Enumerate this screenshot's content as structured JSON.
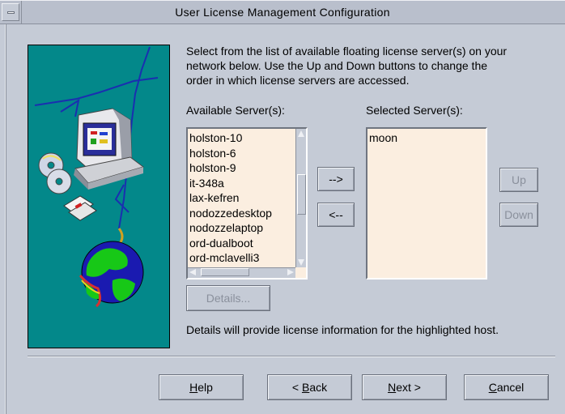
{
  "window": {
    "title": "User License Management Configuration"
  },
  "instructions": {
    "line1": "Select from the list of available floating license server(s) on your",
    "line2": "network below.  Use the Up and Down buttons to change the",
    "line3": "order in which license servers are accessed."
  },
  "available": {
    "label": "Available Server(s):",
    "items": [
      "holston-10",
      "holston-6",
      "holston-9",
      "it-348a",
      "lax-kefren",
      "nodozzedesktop",
      "nodozzelaptop",
      "ord-dualboot",
      "ord-mclavelli3"
    ],
    "scroll_position": 0.45
  },
  "selected": {
    "label": "Selected Server(s):",
    "items": [
      "moon"
    ]
  },
  "buttons": {
    "add": "-->",
    "remove": "<--",
    "up": "Up",
    "down": "Down",
    "details": "Details...",
    "help_mnemonic": "H",
    "help_rest": "elp",
    "back_prefix": "< ",
    "back_mnemonic": "B",
    "back_rest": "ack",
    "next_mnemonic": "N",
    "next_rest": "ext >",
    "cancel_mnemonic": "C",
    "cancel_rest": "ancel"
  },
  "details_note": "Details will provide license information for the highlighted host.",
  "colors": {
    "illustration_background": "#03888a",
    "list_background": "#fbeee0",
    "window_background": "#c5cbd6"
  },
  "icons": {
    "illustration": "computer-globe-network-illustration"
  }
}
